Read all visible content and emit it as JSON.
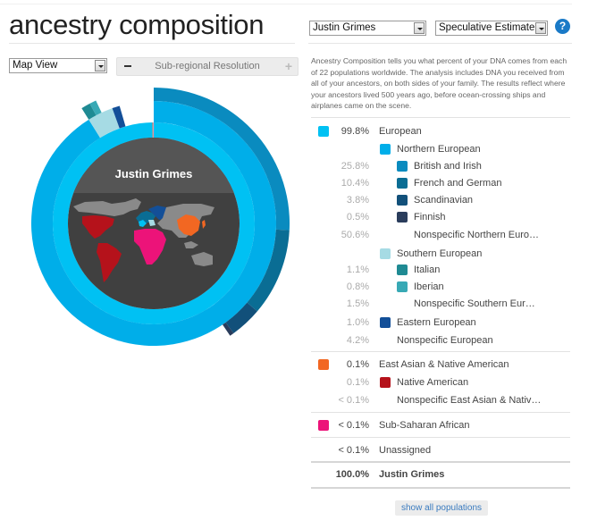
{
  "header": {
    "title": "ancestry composition",
    "person_select": "Justin Grimes",
    "estimate_select": "Speculative Estimate",
    "help_label": "?"
  },
  "controls": {
    "view_select": "Map View",
    "resolution_label": "Sub-regional Resolution",
    "minus_label": "−",
    "plus_label": "+"
  },
  "description": "Ancestry Composition tells you what percent of your DNA comes from each of 22 populations worldwide. The analysis includes DNA you received from all of your ancestors, on both sides of your family. The results reflect where your ancestors lived 500 years ago, before ocean-crossing ships and airplanes came on the scene.",
  "chart_center_label": "Justin Grimes",
  "legend": [
    {
      "pct": "99.8%",
      "label": "European",
      "color": "#00c1f3",
      "level": 0,
      "sub": false
    },
    {
      "pct": "",
      "label": "Northern European",
      "color": "#00aee9",
      "level": 1,
      "sub": true
    },
    {
      "pct": "25.8%",
      "label": "British and Irish",
      "color": "#0a8bbf",
      "level": 2,
      "sub": true
    },
    {
      "pct": "10.4%",
      "label": "French and German",
      "color": "#0a6d94",
      "level": 2,
      "sub": true
    },
    {
      "pct": "3.8%",
      "label": "Scandinavian",
      "color": "#12507a",
      "level": 2,
      "sub": true
    },
    {
      "pct": "0.5%",
      "label": "Finnish",
      "color": "#2a3d5c",
      "level": 2,
      "sub": true
    },
    {
      "pct": "50.6%",
      "label": "Nonspecific Northern Euro…",
      "color": "",
      "level": 2,
      "sub": true
    },
    {
      "pct": "",
      "label": "Southern European",
      "color": "#a6dbe4",
      "level": 1,
      "sub": true
    },
    {
      "pct": "1.1%",
      "label": "Italian",
      "color": "#1f8a93",
      "level": 2,
      "sub": true
    },
    {
      "pct": "0.8%",
      "label": "Iberian",
      "color": "#38a9b5",
      "level": 2,
      "sub": true
    },
    {
      "pct": "1.5%",
      "label": "Nonspecific Southern Eur…",
      "color": "",
      "level": 2,
      "sub": true
    },
    {
      "pct": "1.0%",
      "label": "Eastern European",
      "color": "#134f98",
      "level": 1,
      "sub": true
    },
    {
      "pct": "4.2%",
      "label": "Nonspecific European",
      "color": "",
      "level": 1,
      "sub": true
    },
    {
      "pct": "0.1%",
      "label": "East Asian & Native American",
      "color": "#f26722",
      "level": 0,
      "sub": false
    },
    {
      "pct": "0.1%",
      "label": "Native American",
      "color": "#b5121b",
      "level": 1,
      "sub": true
    },
    {
      "pct": "< 0.1%",
      "label": "Nonspecific East Asian & Nativ…",
      "color": "",
      "level": 1,
      "sub": true
    },
    {
      "pct": "< 0.1%",
      "label": "Sub-Saharan African",
      "color": "#ec1379",
      "level": 0,
      "sub": false
    },
    {
      "pct": "< 0.1%",
      "label": "Unassigned",
      "color": "",
      "level": 0,
      "sub": false
    },
    {
      "pct": "100.0%",
      "label": "Justin Grimes",
      "color": "",
      "level": 0,
      "sub": false,
      "bold": true
    }
  ],
  "show_all_label": "show all populations",
  "colors": {
    "european": "#00c1f3",
    "northern_european": "#00aee9",
    "southern_european": "#a6dbe4",
    "eastern_european": "#134f98",
    "british_irish": "#0a8bbf",
    "french_german": "#0a6d94",
    "scandinavian": "#12507a",
    "finnish": "#2a3d5c",
    "italian": "#1f8a93",
    "iberian": "#38a9b5",
    "east_asian": "#f26722",
    "native_american": "#b5121b",
    "sub_saharan": "#ec1379",
    "map_land": "#8a8a8a",
    "center_bg": "#454545"
  },
  "chart_data": {
    "type": "sunburst",
    "title": "Justin Grimes",
    "rings": [
      {
        "name": "level-1",
        "segments": [
          {
            "label": "European",
            "value": 99.8,
            "color": "#00c1f3"
          },
          {
            "label": "East Asian & Native American",
            "value": 0.1,
            "color": "#f26722"
          },
          {
            "label": "Sub-Saharan African",
            "value": 0.05,
            "color": "#ec1379"
          },
          {
            "label": "Unassigned",
            "value": 0.05,
            "color": ""
          }
        ]
      },
      {
        "name": "level-2",
        "segments": [
          {
            "label": "Northern European",
            "value": 91.1,
            "color": "#00aee9"
          },
          {
            "label": "Southern European",
            "value": 3.4,
            "color": "#a6dbe4"
          },
          {
            "label": "Eastern European",
            "value": 1.0,
            "color": "#134f98"
          },
          {
            "label": "Nonspecific European",
            "value": 4.2,
            "color": ""
          }
        ]
      },
      {
        "name": "level-3",
        "segments": [
          {
            "label": "British and Irish",
            "value": 25.8,
            "color": "#0a8bbf"
          },
          {
            "label": "French and German",
            "value": 10.4,
            "color": "#0a6d94"
          },
          {
            "label": "Scandinavian",
            "value": 3.8,
            "color": "#12507a"
          },
          {
            "label": "Finnish",
            "value": 0.5,
            "color": "#2a3d5c"
          },
          {
            "label": "Nonspecific Northern European",
            "value": 50.6,
            "color": ""
          },
          {
            "label": "Italian",
            "value": 1.1,
            "color": "#1f8a93"
          },
          {
            "label": "Iberian",
            "value": 0.8,
            "color": "#38a9b5"
          },
          {
            "label": "Nonspecific Southern European",
            "value": 1.5,
            "color": ""
          }
        ]
      }
    ]
  }
}
